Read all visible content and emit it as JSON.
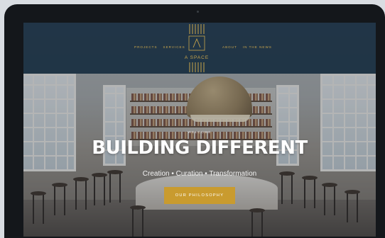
{
  "nav": {
    "left": [
      {
        "label": "PROJECTS"
      },
      {
        "label": "SERVICES"
      }
    ],
    "right": [
      {
        "label": "ABOUT"
      },
      {
        "label": "IN THE NEWS"
      }
    ]
  },
  "brand": {
    "name": "A SPACE"
  },
  "hero": {
    "kicker": "WELCOME",
    "headline": "BUILDING DIFFERENT",
    "tagline": "Creation • Curation • Transformation",
    "cta_label": "OUR PHILOSOPHY"
  },
  "colors": {
    "accent": "#c99b2f",
    "header_bg": "#182e40",
    "logo_gold": "#c9a54b"
  }
}
